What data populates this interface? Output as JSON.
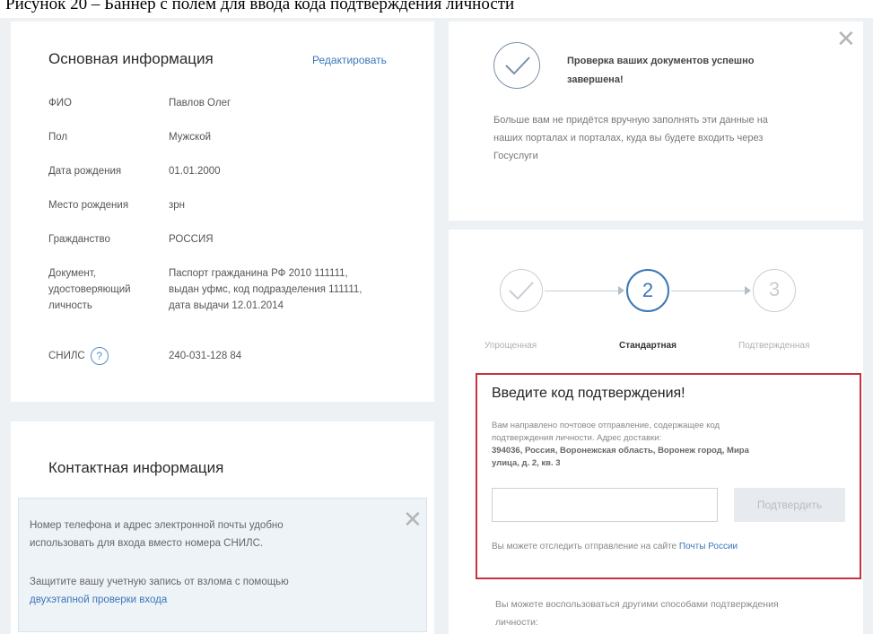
{
  "caption": "Рисунок 20 – Баннер с полем для ввода кода подтверждения личности",
  "basic_info": {
    "title": "Основная информация",
    "edit_link": "Редактировать",
    "rows": [
      {
        "label": "ФИО",
        "value": "Павлов Олег"
      },
      {
        "label": "Пол",
        "value": "Мужской"
      },
      {
        "label": "Дата рождения",
        "value": "01.01.2000"
      },
      {
        "label": "Место рождения",
        "value": "зрн"
      },
      {
        "label": "Гражданство",
        "value": "РОССИЯ"
      }
    ],
    "document": {
      "label_lines": [
        "Документ,",
        "удостоверяющий",
        "личность"
      ],
      "value_lines": [
        "Паспорт гражданина РФ 2010 111111,",
        "выдан уфмс, код подразделения 111111,",
        "дата выдачи 12.01.2014"
      ]
    },
    "snils": {
      "label": "СНИЛС",
      "help": "?",
      "value": "240-031-128 84"
    }
  },
  "contact_info": {
    "title": "Контактная информация",
    "banner_lines": [
      "Номер телефона и адрес электронной почты удобно",
      "использовать для входа вместо номера СНИЛС."
    ],
    "protect_text": "Защитите вашу учетную запись от взлома с помощью",
    "protect_link": "двухэтапной проверки входа",
    "close": "✕"
  },
  "check_panel": {
    "title_lines": [
      "Проверка ваших документов успешно",
      "завершена!"
    ],
    "body_lines": [
      "Больше вам не придётся вручную заполнять эти данные на",
      "наших порталах и порталах, куда вы будете входить через",
      "Госуслуги"
    ],
    "close": "✕"
  },
  "steps": [
    {
      "number": "",
      "label": "Упрощенная"
    },
    {
      "number": "2",
      "label": "Стандартная"
    },
    {
      "number": "3",
      "label": "Подтвержденная"
    }
  ],
  "code_panel": {
    "title": "Введите код подтверждения!",
    "body_lines": [
      "Вам направлено почтовое отправление, содержащее код",
      "подтверждения личности. Адрес доставки:"
    ],
    "address_lines": [
      "394036, Россия, Воронежская область, Воронеж город, Мира",
      "улица, д. 2, кв. 3"
    ],
    "input_value": "",
    "confirm_button": "Подтвердить",
    "track_text": "Вы можете отследить отправление на сайте",
    "track_link": "Почты России"
  },
  "other_ways": [
    "Вы можете воспользоваться другими способами подтверждения",
    "личности:"
  ],
  "colors": {
    "accent": "#3a77b8",
    "highlight_border": "#c8323c",
    "background": "#eef1f4"
  }
}
